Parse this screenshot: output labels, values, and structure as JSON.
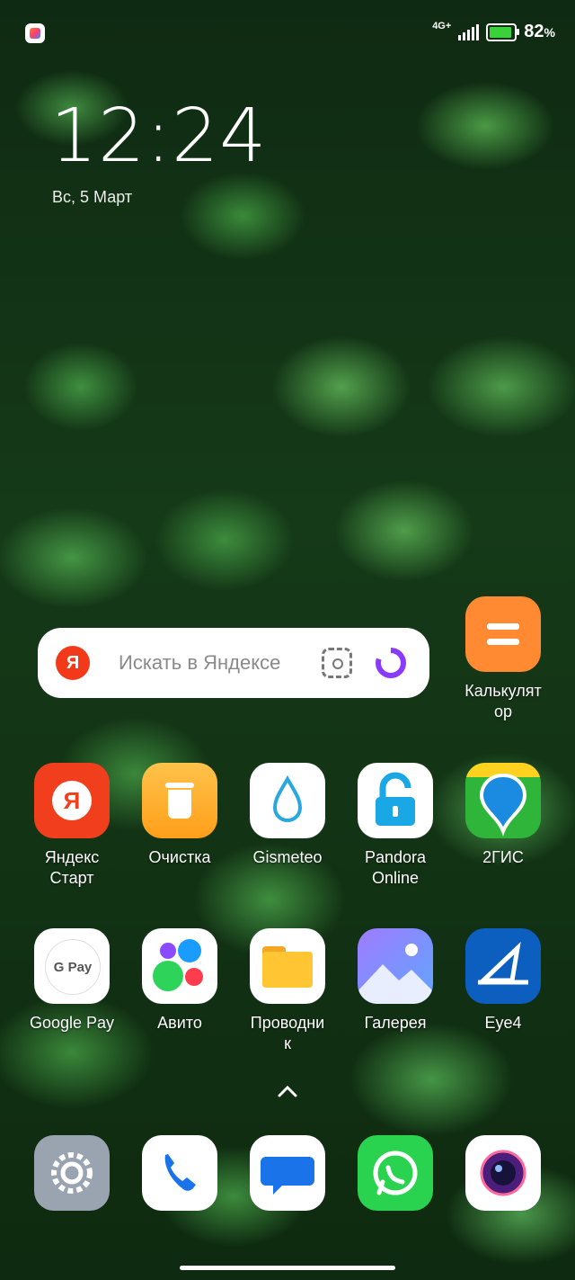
{
  "status_bar": {
    "network": "4G+",
    "battery_percent": "82",
    "battery_unit": "%"
  },
  "clock": {
    "time": "12:24",
    "date": "Вс, 5 Март"
  },
  "search_widget": {
    "placeholder": "Искать в Яндексе",
    "badge": "Я"
  },
  "apps": {
    "calculator": "Калькулят\nор",
    "row1": [
      "Яндекс\nСтарт",
      "Очистка",
      "Gismeteo",
      "Pandora\nOnline",
      "2ГИС"
    ],
    "row2": [
      "Google Pay",
      "Авито",
      "Проводни\nк",
      "Галерея",
      "Eye4"
    ]
  },
  "yandex_start_badge": "Я",
  "gpay_badge": "G Pay",
  "dock": [
    "Settings",
    "Phone",
    "Messages",
    "WhatsApp",
    "Camera"
  ]
}
